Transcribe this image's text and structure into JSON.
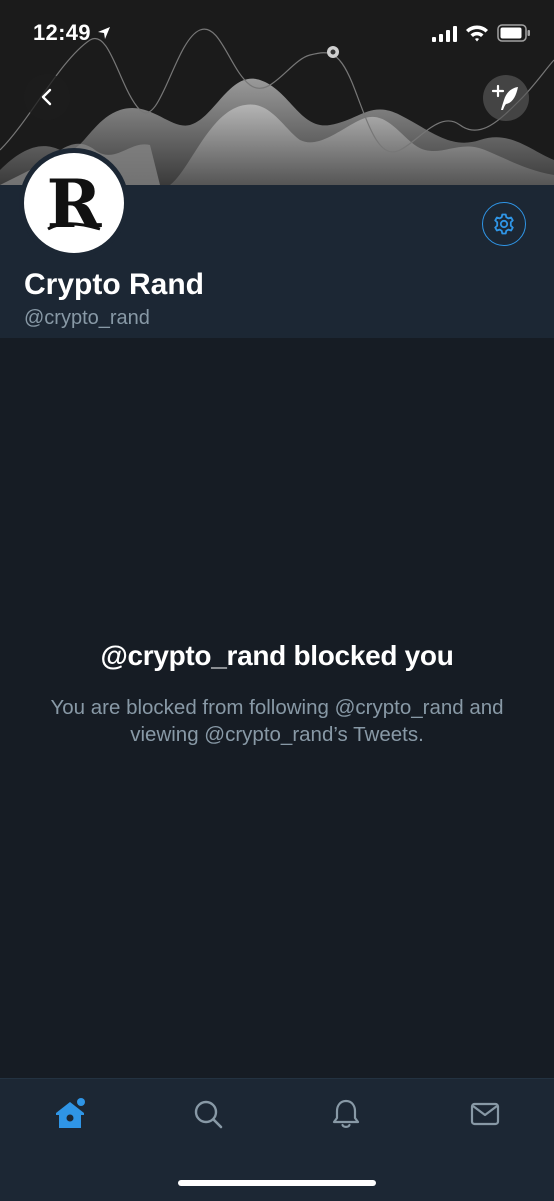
{
  "status_bar": {
    "time": "12:49",
    "icons": [
      "location-arrow-icon",
      "cellular-signal-icon",
      "wifi-icon",
      "battery-icon"
    ]
  },
  "header": {
    "back_icon": "chevron-left-icon",
    "compose_icon": "plus-feather-compose-icon"
  },
  "profile": {
    "avatar_letter": "R",
    "display_name": "Crypto Rand",
    "handle": "@crypto_rand",
    "settings_icon": "gear-icon"
  },
  "blocked": {
    "title": "@crypto_rand blocked you",
    "message": "You are blocked from following @crypto_rand and viewing @crypto_rand’s Tweets."
  },
  "tabbar": {
    "tabs": [
      {
        "name": "home",
        "icon": "home-icon",
        "active": true
      },
      {
        "name": "search",
        "icon": "search-icon",
        "active": false
      },
      {
        "name": "notifications",
        "icon": "bell-icon",
        "active": false
      },
      {
        "name": "messages",
        "icon": "envelope-icon",
        "active": false
      }
    ]
  },
  "colors": {
    "accent": "#2f95e6",
    "background": "#161c24",
    "panel": "#1c2734",
    "secondary_text": "#8899a6"
  }
}
